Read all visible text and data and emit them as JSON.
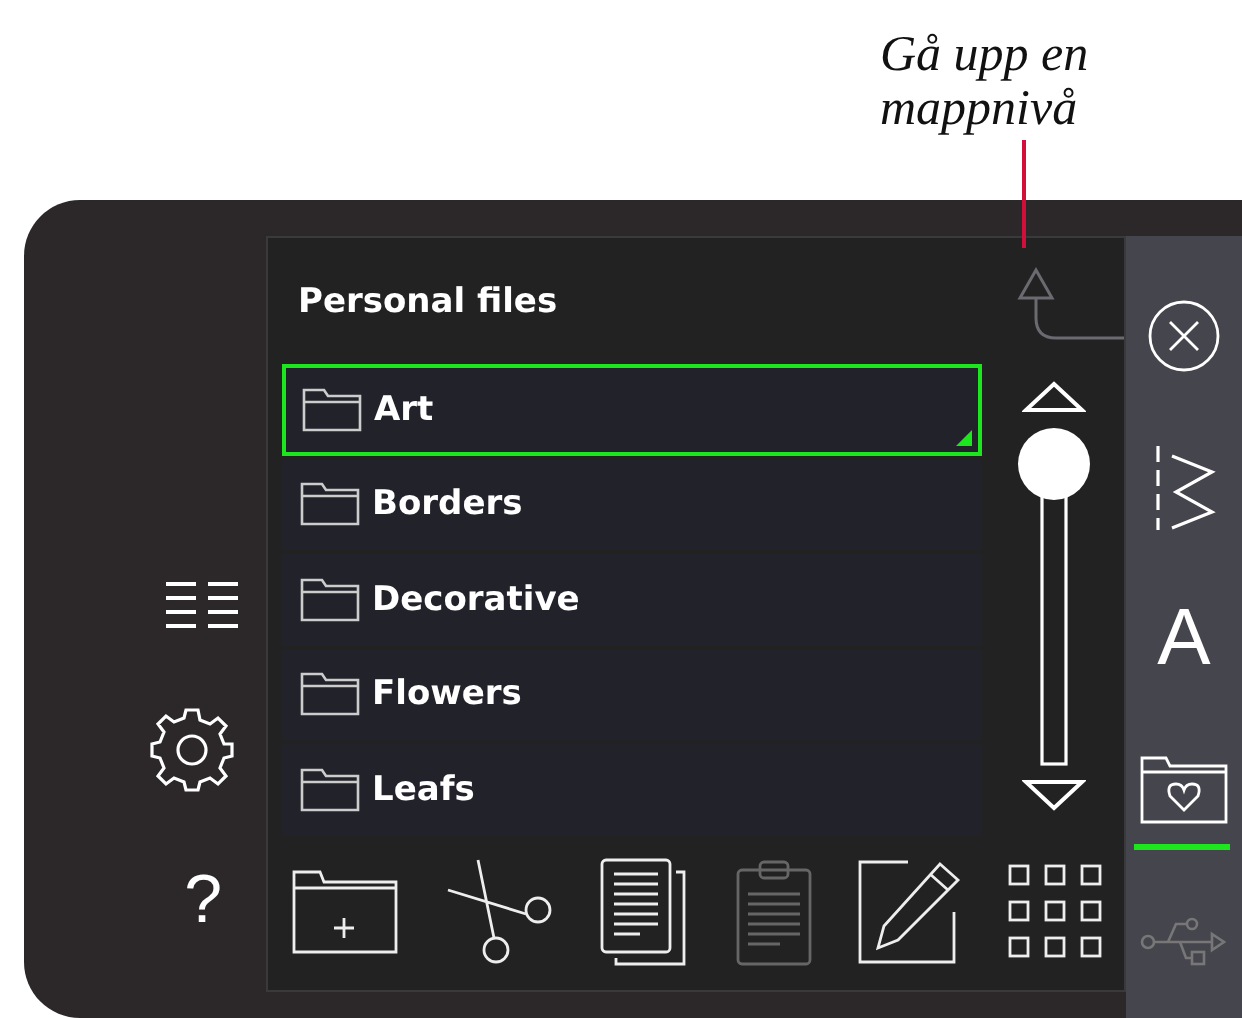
{
  "annotation": {
    "text": "Gå upp en mappnivå"
  },
  "left_tools": [
    {
      "kind": "list"
    },
    {
      "kind": "settings"
    },
    {
      "kind": "help",
      "label": "?"
    }
  ],
  "browser": {
    "title": "Personal files",
    "up_button": {
      "disabled": true
    },
    "items": [
      {
        "name": "Art",
        "selected": true
      },
      {
        "name": "Borders",
        "selected": false
      },
      {
        "name": "Decorative",
        "selected": false
      },
      {
        "name": "Flowers",
        "selected": false
      },
      {
        "name": "Leafs",
        "selected": false
      }
    ]
  },
  "toolbar": [
    {
      "kind": "new-folder",
      "disabled": false
    },
    {
      "kind": "cut",
      "disabled": false
    },
    {
      "kind": "copy",
      "disabled": false
    },
    {
      "kind": "paste",
      "disabled": true
    },
    {
      "kind": "rename",
      "disabled": false
    },
    {
      "kind": "grid",
      "disabled": false
    }
  ],
  "sidebar": [
    {
      "kind": "close",
      "selected": false,
      "disabled": false
    },
    {
      "kind": "stitch",
      "selected": false,
      "disabled": false
    },
    {
      "kind": "font",
      "label": "A",
      "selected": false,
      "disabled": false
    },
    {
      "kind": "personal-folder",
      "selected": true,
      "disabled": false
    },
    {
      "kind": "usb",
      "selected": false,
      "disabled": true
    }
  ]
}
